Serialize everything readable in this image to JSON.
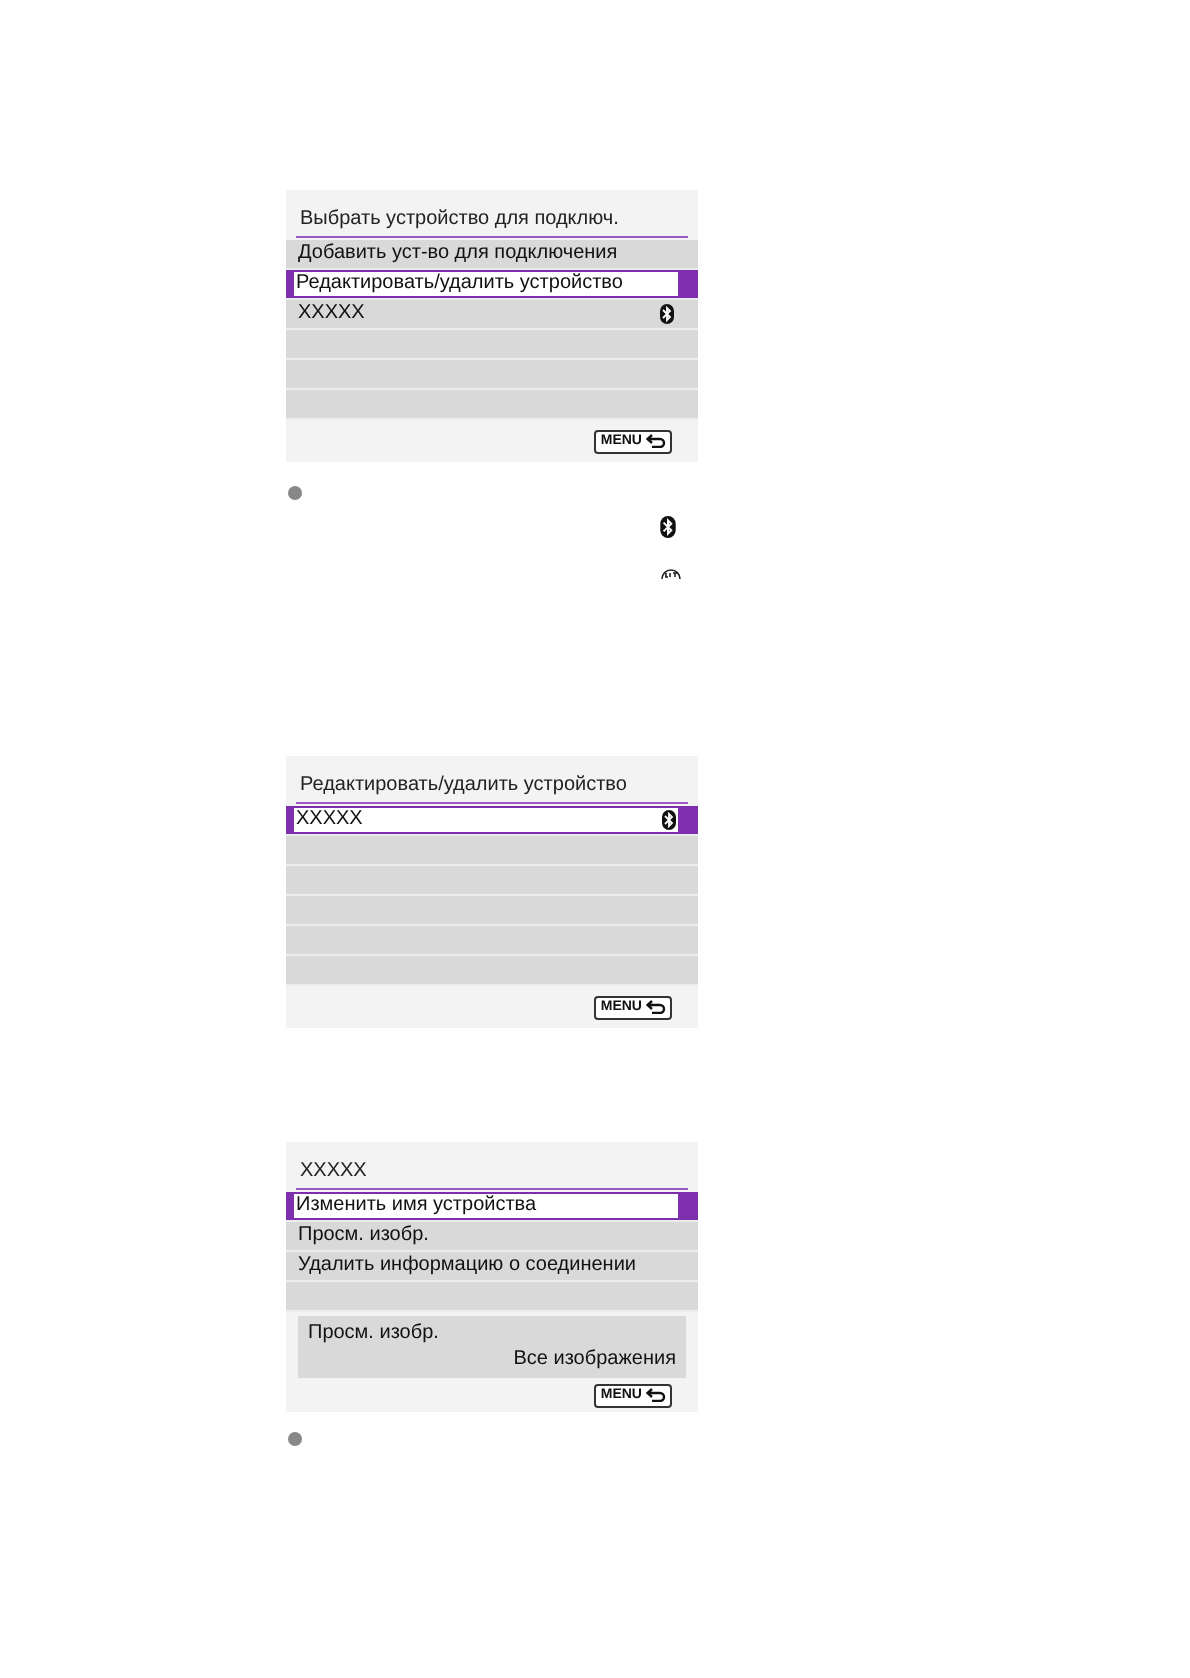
{
  "screens": [
    {
      "title": "Выбрать устройство для подключ.",
      "items": [
        {
          "label": "Добавить уст-во для подключения",
          "selected": false,
          "bluetooth": false
        },
        {
          "label": "Редактировать/удалить устройство",
          "selected": true,
          "bluetooth": false
        },
        {
          "label": "XXXXX",
          "selected": false,
          "bluetooth": true
        }
      ],
      "menu_button": "MENU"
    },
    {
      "title": "Редактировать/удалить устройство",
      "items": [
        {
          "label": "XXXXX",
          "selected": true,
          "bluetooth": true
        }
      ],
      "menu_button": "MENU"
    },
    {
      "title": "XXXXX",
      "items": [
        {
          "label": "Изменить имя устройства",
          "selected": true,
          "bluetooth": false
        },
        {
          "label": "Просм. изобр.",
          "selected": false,
          "bluetooth": false
        },
        {
          "label": "Удалить информацию о соединении",
          "selected": false,
          "bluetooth": false
        }
      ],
      "info": {
        "label": "Просм. изобр.",
        "value": "Все изображения"
      },
      "menu_button": "MENU"
    }
  ]
}
